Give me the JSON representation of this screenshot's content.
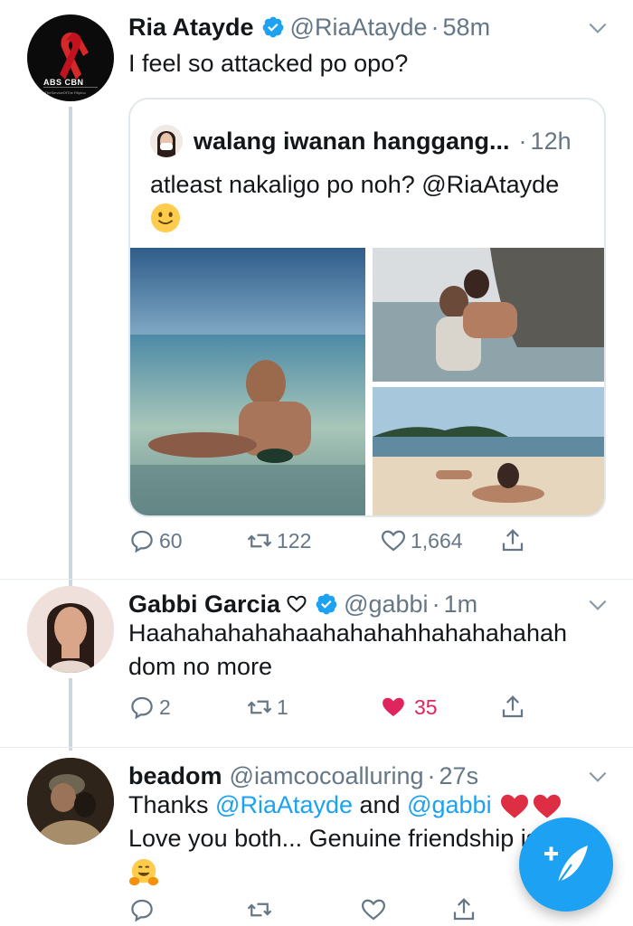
{
  "tweets": [
    {
      "name": "Ria Atayde",
      "handle": "@RiaAtayde",
      "time": "58m",
      "text": "I feel so attacked po opo?",
      "avatar_text": "ABS CBN",
      "avatar_subtext": "#InTheServiceOfThe Filipino",
      "quote": {
        "name": "walang iwanan hanggang...",
        "time": "12h",
        "text": "atleast nakaligo po noh? @RiaAtayde",
        "text_plain": "atleast nakaligo po noh? ",
        "mention": "@RiaAtayde"
      },
      "actions": {
        "replies": "60",
        "retweets": "122",
        "likes": "1,664"
      }
    },
    {
      "name": "Gabbi Garcia",
      "handle": "@gabbi",
      "time": "1m",
      "text_line1": "Haahahahahahaahahahahhahahahahah",
      "text_line2": "dom no more",
      "actions": {
        "replies": "2",
        "retweets": "1",
        "likes": "35"
      }
    },
    {
      "name": "beadom",
      "handle": "@iamcocoalluring",
      "time": "27s",
      "line1_a": "Thanks ",
      "mention1": "@RiaAtayde",
      "line1_b": " and ",
      "mention2": "@gabbi",
      "line2": "Love you both... Genuine friendship is"
    }
  ],
  "colors": {
    "accent": "#1da1f2",
    "like_active": "#e0245e",
    "secondary_text": "#657786",
    "thread_line": "#ccd6dd"
  },
  "icons": [
    "verified-icon",
    "chevron-down-icon",
    "reply-icon",
    "retweet-icon",
    "like-icon",
    "share-icon",
    "compose-tweet-icon"
  ]
}
